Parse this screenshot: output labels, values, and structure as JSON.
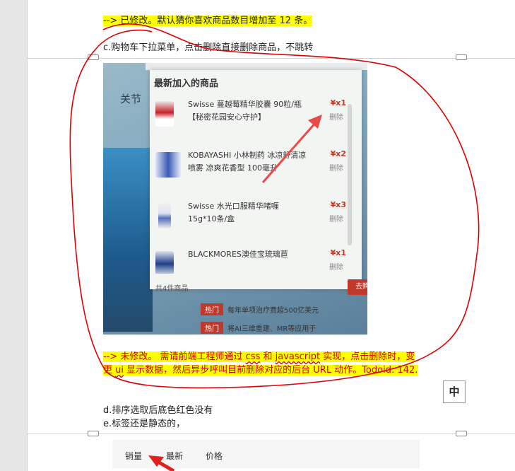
{
  "doc": {
    "line1": "--> 已修改。默认猜你喜欢商品数目增加至 12 条。",
    "line2": "c.购物车下拉菜单，点击删除直接删除商品，不跳转",
    "note_a": "--> 未修改。 需请前端工程师通过 ",
    "note_css": "css",
    "note_b": " 和 ",
    "note_js": "javascript",
    "note_c": " 实现，点击删除时，变",
    "note2_a": "更 ",
    "note2_ui": "ui",
    "note2_b": " 显示数据，然后异步呼叫目前删除对应的后台 URL 动作。Todoid: 142.",
    "zh_button": "中",
    "line_d": "d.排序选取后底色红色没有",
    "line_e": "e.标签还是静态的，"
  },
  "photo": {
    "bg_title": "关节",
    "panel_title": "最新加入的商品",
    "items": [
      {
        "name": "Swisse 蔓越莓精华胶囊 90粒/瓶【秘密花园安心守护】",
        "qty": "¥x1",
        "delete": "删除"
      },
      {
        "name": "KOBAYASHI 小林制药 冰凉舒清凉喷雾 凉爽花香型 100毫升",
        "qty": "¥x2",
        "delete": "删除"
      },
      {
        "name": "Swisse 水光口服精华啫喱 15g*10条/盒",
        "qty": "¥x3",
        "delete": "删除"
      },
      {
        "name": "BLACKMORES澳佳宝琉璃苣",
        "qty": "¥x1",
        "delete": "删除"
      }
    ],
    "count_text": "共4件商品",
    "checkout": "去购物车",
    "promo1_tag": "热门",
    "promo1_text": "每年单项治疗费超500亿美元",
    "promo2_tag": "热门",
    "promo2_text": "将AI三维重建、MR等应用于"
  },
  "sortbar": {
    "sales": "销量",
    "newest": "最新",
    "price": "价格"
  },
  "colors": {
    "highlight": "#ffff00",
    "annotation_red": "#e00000",
    "note_text": "#d40000"
  }
}
